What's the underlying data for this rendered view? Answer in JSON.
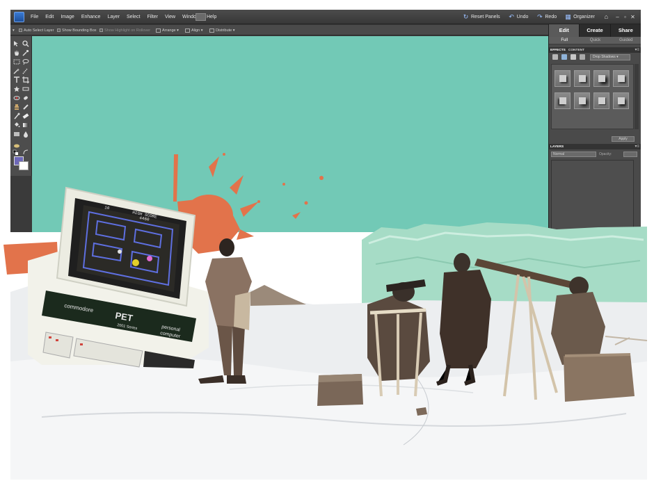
{
  "app": {
    "menu": [
      "File",
      "Edit",
      "Image",
      "Enhance",
      "Layer",
      "Select",
      "Filter",
      "View",
      "Window",
      "Help"
    ],
    "actions": {
      "reset_panels": "Reset Panels",
      "undo": "Undo",
      "redo": "Redo",
      "organizer": "Organizer"
    },
    "options": {
      "auto_select": "Auto Select Layer",
      "bounding_box": "Show Bounding Box",
      "highlight": "Show Highlight on Rollover",
      "arrange": "Arrange",
      "align": "Align",
      "distribute": "Distribute"
    },
    "colors": {
      "foreground": "#6d68b8",
      "background": "#ffffff",
      "canvas": "#72c9b6"
    }
  },
  "panel": {
    "tabs": [
      "Edit",
      "Create",
      "Share"
    ],
    "subtabs": [
      "Full",
      "Quick",
      "Guided"
    ],
    "effects_tab": "EFFECTS",
    "content_tab": "CONTENT",
    "effect_dropdown": "Drop Shadows",
    "apply": "Apply",
    "layers_tab": "LAYERS",
    "blend_mode": "Normal",
    "opacity_label": "Opacity:"
  },
  "collage": {
    "screen": {
      "high_score": "HIGH SCORE",
      "score_left": "10",
      "score_right": "4460"
    },
    "computer": {
      "brand": "commodore",
      "model": "PET",
      "series": "2001 Series",
      "desc_line1": "personal",
      "desc_line2": "computer"
    }
  }
}
